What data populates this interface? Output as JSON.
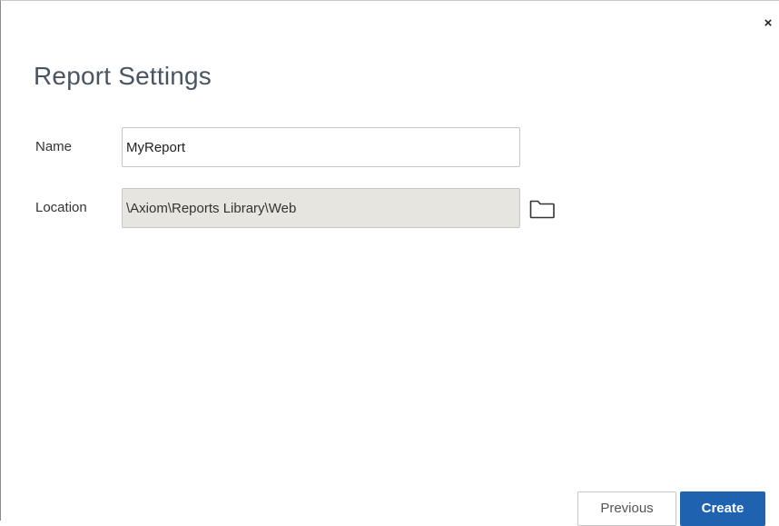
{
  "dialog": {
    "title": "Report Settings",
    "close_label": "×"
  },
  "form": {
    "name_label": "Name",
    "name_value": "MyReport",
    "location_label": "Location",
    "location_value": "\\Axiom\\Reports Library\\Web"
  },
  "footer": {
    "previous_label": "Previous",
    "create_label": "Create"
  },
  "colors": {
    "primary": "#1f62b0",
    "readonly_bg": "#e6e5df",
    "title_text": "#4a5562"
  },
  "icons": {
    "close": "close-icon",
    "browse": "folder-icon"
  }
}
